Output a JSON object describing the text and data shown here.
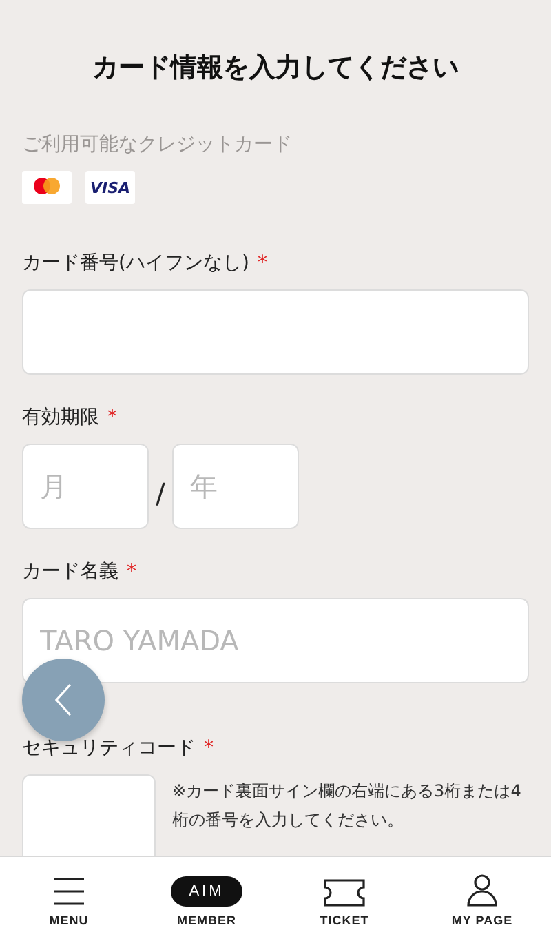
{
  "title": "カード情報を入力してください",
  "accepted_cards": {
    "label": "ご利用可能なクレジットカード",
    "cards": [
      {
        "kind": "mastercard"
      },
      {
        "kind": "visa",
        "text": "VISA"
      }
    ]
  },
  "card_number": {
    "label": "カード番号(ハイフンなし)",
    "required_mark": "*"
  },
  "expiry": {
    "label": "有効期限",
    "required_mark": "*",
    "month_placeholder": "月",
    "separator": "/",
    "year_placeholder": "年"
  },
  "card_name": {
    "label": "カード名義",
    "required_mark": "*",
    "placeholder": "TARO YAMADA"
  },
  "security_code": {
    "label": "セキュリティコード",
    "required_mark": "*",
    "note": "※カード裏面サイン欄の右端にある3桁または4桁の番号を入力してください。"
  },
  "nav": [
    {
      "kind": "menu",
      "label": "MENU"
    },
    {
      "kind": "logo",
      "logo_text": "AIM",
      "label": "MEMBER"
    },
    {
      "kind": "ticket",
      "label": "TICKET"
    },
    {
      "kind": "person",
      "label": "MY PAGE"
    }
  ]
}
